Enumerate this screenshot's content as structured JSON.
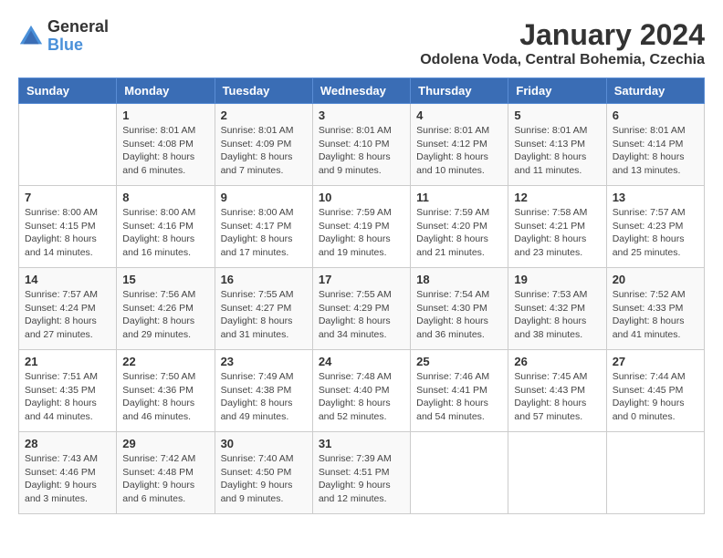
{
  "logo": {
    "line1": "General",
    "line2": "Blue"
  },
  "title": "January 2024",
  "location": "Odolena Voda, Central Bohemia, Czechia",
  "days_of_week": [
    "Sunday",
    "Monday",
    "Tuesday",
    "Wednesday",
    "Thursday",
    "Friday",
    "Saturday"
  ],
  "weeks": [
    [
      {
        "day": "",
        "info": ""
      },
      {
        "day": "1",
        "info": "Sunrise: 8:01 AM\nSunset: 4:08 PM\nDaylight: 8 hours\nand 6 minutes."
      },
      {
        "day": "2",
        "info": "Sunrise: 8:01 AM\nSunset: 4:09 PM\nDaylight: 8 hours\nand 7 minutes."
      },
      {
        "day": "3",
        "info": "Sunrise: 8:01 AM\nSunset: 4:10 PM\nDaylight: 8 hours\nand 9 minutes."
      },
      {
        "day": "4",
        "info": "Sunrise: 8:01 AM\nSunset: 4:12 PM\nDaylight: 8 hours\nand 10 minutes."
      },
      {
        "day": "5",
        "info": "Sunrise: 8:01 AM\nSunset: 4:13 PM\nDaylight: 8 hours\nand 11 minutes."
      },
      {
        "day": "6",
        "info": "Sunrise: 8:01 AM\nSunset: 4:14 PM\nDaylight: 8 hours\nand 13 minutes."
      }
    ],
    [
      {
        "day": "7",
        "info": "Sunrise: 8:00 AM\nSunset: 4:15 PM\nDaylight: 8 hours\nand 14 minutes."
      },
      {
        "day": "8",
        "info": "Sunrise: 8:00 AM\nSunset: 4:16 PM\nDaylight: 8 hours\nand 16 minutes."
      },
      {
        "day": "9",
        "info": "Sunrise: 8:00 AM\nSunset: 4:17 PM\nDaylight: 8 hours\nand 17 minutes."
      },
      {
        "day": "10",
        "info": "Sunrise: 7:59 AM\nSunset: 4:19 PM\nDaylight: 8 hours\nand 19 minutes."
      },
      {
        "day": "11",
        "info": "Sunrise: 7:59 AM\nSunset: 4:20 PM\nDaylight: 8 hours\nand 21 minutes."
      },
      {
        "day": "12",
        "info": "Sunrise: 7:58 AM\nSunset: 4:21 PM\nDaylight: 8 hours\nand 23 minutes."
      },
      {
        "day": "13",
        "info": "Sunrise: 7:57 AM\nSunset: 4:23 PM\nDaylight: 8 hours\nand 25 minutes."
      }
    ],
    [
      {
        "day": "14",
        "info": "Sunrise: 7:57 AM\nSunset: 4:24 PM\nDaylight: 8 hours\nand 27 minutes."
      },
      {
        "day": "15",
        "info": "Sunrise: 7:56 AM\nSunset: 4:26 PM\nDaylight: 8 hours\nand 29 minutes."
      },
      {
        "day": "16",
        "info": "Sunrise: 7:55 AM\nSunset: 4:27 PM\nDaylight: 8 hours\nand 31 minutes."
      },
      {
        "day": "17",
        "info": "Sunrise: 7:55 AM\nSunset: 4:29 PM\nDaylight: 8 hours\nand 34 minutes."
      },
      {
        "day": "18",
        "info": "Sunrise: 7:54 AM\nSunset: 4:30 PM\nDaylight: 8 hours\nand 36 minutes."
      },
      {
        "day": "19",
        "info": "Sunrise: 7:53 AM\nSunset: 4:32 PM\nDaylight: 8 hours\nand 38 minutes."
      },
      {
        "day": "20",
        "info": "Sunrise: 7:52 AM\nSunset: 4:33 PM\nDaylight: 8 hours\nand 41 minutes."
      }
    ],
    [
      {
        "day": "21",
        "info": "Sunrise: 7:51 AM\nSunset: 4:35 PM\nDaylight: 8 hours\nand 44 minutes."
      },
      {
        "day": "22",
        "info": "Sunrise: 7:50 AM\nSunset: 4:36 PM\nDaylight: 8 hours\nand 46 minutes."
      },
      {
        "day": "23",
        "info": "Sunrise: 7:49 AM\nSunset: 4:38 PM\nDaylight: 8 hours\nand 49 minutes."
      },
      {
        "day": "24",
        "info": "Sunrise: 7:48 AM\nSunset: 4:40 PM\nDaylight: 8 hours\nand 52 minutes."
      },
      {
        "day": "25",
        "info": "Sunrise: 7:46 AM\nSunset: 4:41 PM\nDaylight: 8 hours\nand 54 minutes."
      },
      {
        "day": "26",
        "info": "Sunrise: 7:45 AM\nSunset: 4:43 PM\nDaylight: 8 hours\nand 57 minutes."
      },
      {
        "day": "27",
        "info": "Sunrise: 7:44 AM\nSunset: 4:45 PM\nDaylight: 9 hours\nand 0 minutes."
      }
    ],
    [
      {
        "day": "28",
        "info": "Sunrise: 7:43 AM\nSunset: 4:46 PM\nDaylight: 9 hours\nand 3 minutes."
      },
      {
        "day": "29",
        "info": "Sunrise: 7:42 AM\nSunset: 4:48 PM\nDaylight: 9 hours\nand 6 minutes."
      },
      {
        "day": "30",
        "info": "Sunrise: 7:40 AM\nSunset: 4:50 PM\nDaylight: 9 hours\nand 9 minutes."
      },
      {
        "day": "31",
        "info": "Sunrise: 7:39 AM\nSunset: 4:51 PM\nDaylight: 9 hours\nand 12 minutes."
      },
      {
        "day": "",
        "info": ""
      },
      {
        "day": "",
        "info": ""
      },
      {
        "day": "",
        "info": ""
      }
    ]
  ]
}
